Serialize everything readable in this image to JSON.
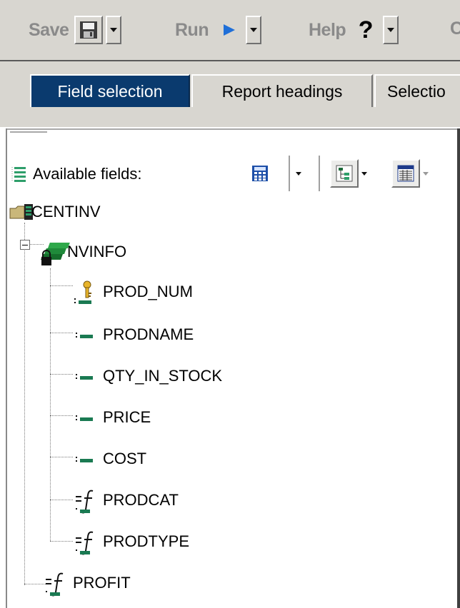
{
  "toolbar": {
    "save_label": "Save",
    "run_label": "Run",
    "help_label": "Help",
    "cut_label": "C",
    "save_icon": "floppy-disk-icon",
    "run_icon": "play-icon",
    "help_icon": "question-mark-icon"
  },
  "tabs": [
    {
      "label": "Field selection",
      "active": true
    },
    {
      "label": "Report headings",
      "active": false
    },
    {
      "label": "Selectio",
      "active": false
    }
  ],
  "fields_panel": {
    "title": "Available fields:",
    "tools": [
      "calculator-icon",
      "tree-view-icon",
      "list-view-icon"
    ]
  },
  "tree": {
    "root": {
      "label": "CENTINV",
      "icon": "folder-table-icon"
    },
    "segment": {
      "label": "NVINFO",
      "icon": "locked-segment-icon",
      "expanded": true
    },
    "fields": [
      {
        "label": "PROD_NUM",
        "icon": "key-field-icon"
      },
      {
        "label": "PRODNAME",
        "icon": "field-icon"
      },
      {
        "label": "QTY_IN_STOCK",
        "icon": "field-icon"
      },
      {
        "label": "PRICE",
        "icon": "field-icon"
      },
      {
        "label": "COST",
        "icon": "field-icon"
      },
      {
        "label": "PRODCAT",
        "icon": "computed-field-icon"
      },
      {
        "label": "PRODTYPE",
        "icon": "computed-field-icon"
      }
    ],
    "extra": {
      "label": "PROFIT",
      "icon": "computed-field-icon"
    }
  },
  "colors": {
    "toolbar_bg": "#d8d6d0",
    "active_tab": "#0a3a6e",
    "label_gray": "#8a8a8a"
  }
}
